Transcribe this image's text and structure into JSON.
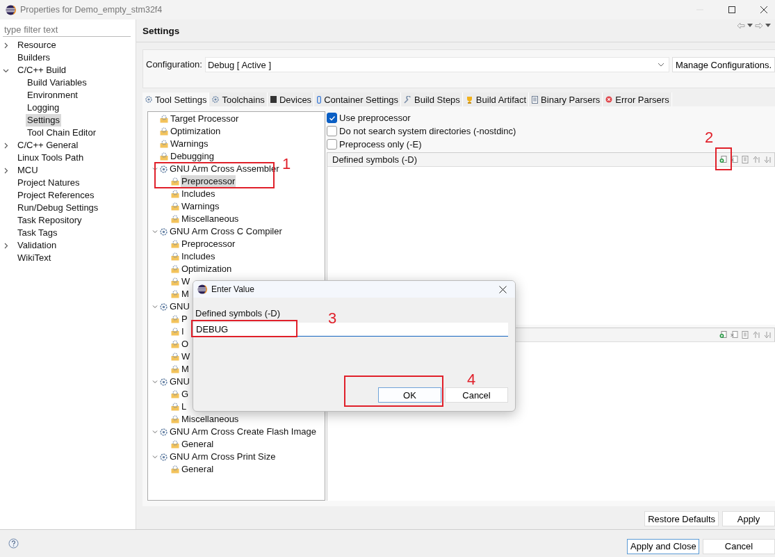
{
  "window": {
    "title": "Properties for Demo_empty_stm32f4"
  },
  "filter": {
    "placeholder": "type filter text"
  },
  "sidebar": {
    "items": [
      {
        "label": "Resource",
        "kind": "folder",
        "expanded": false,
        "selected": false
      },
      {
        "label": "Builders",
        "kind": "leaf",
        "selected": false
      },
      {
        "label": "C/C++ Build",
        "kind": "folder",
        "expanded": true,
        "selected": false,
        "children": [
          {
            "label": "Build Variables",
            "selected": false
          },
          {
            "label": "Environment",
            "selected": false
          },
          {
            "label": "Logging",
            "selected": false
          },
          {
            "label": "Settings",
            "selected": true
          },
          {
            "label": "Tool Chain Editor",
            "selected": false
          }
        ]
      },
      {
        "label": "C/C++ General",
        "kind": "folder",
        "expanded": false,
        "selected": false
      },
      {
        "label": "Linux Tools Path",
        "kind": "leaf",
        "selected": false
      },
      {
        "label": "MCU",
        "kind": "folder",
        "expanded": false,
        "selected": false
      },
      {
        "label": "Project Natures",
        "kind": "leaf",
        "selected": false
      },
      {
        "label": "Project References",
        "kind": "leaf",
        "selected": false
      },
      {
        "label": "Run/Debug Settings",
        "kind": "leaf",
        "selected": false
      },
      {
        "label": "Task Repository",
        "kind": "leaf",
        "selected": false
      },
      {
        "label": "Task Tags",
        "kind": "leaf",
        "selected": false
      },
      {
        "label": "Validation",
        "kind": "folder",
        "expanded": false,
        "selected": false
      },
      {
        "label": "WikiText",
        "kind": "leaf",
        "selected": false
      }
    ]
  },
  "page": {
    "title": "Settings"
  },
  "configuration": {
    "label": "Configuration:",
    "value": "Debug  [ Active ]",
    "manage_button": "Manage Configurations."
  },
  "tabs": [
    {
      "label": "Tool Settings",
      "kind": "tool",
      "selected": true
    },
    {
      "label": "Toolchains",
      "kind": "tool",
      "selected": false
    },
    {
      "label": "Devices",
      "kind": "device",
      "selected": false
    },
    {
      "label": "Container Settings",
      "kind": "container",
      "selected": false
    },
    {
      "label": "Build Steps",
      "kind": "steps",
      "selected": false
    },
    {
      "label": "Build Artifact",
      "kind": "artifact",
      "selected": false
    },
    {
      "label": "Binary Parsers",
      "kind": "parser",
      "selected": false
    },
    {
      "label": "Error Parsers",
      "kind": "error",
      "selected": false
    }
  ],
  "tool_tree": [
    {
      "kind": "option",
      "label": "Target Processor",
      "selected": false
    },
    {
      "kind": "option",
      "label": "Optimization",
      "selected": false
    },
    {
      "kind": "option",
      "label": "Warnings",
      "selected": false
    },
    {
      "kind": "option",
      "label": "Debugging",
      "selected": false
    },
    {
      "kind": "tool",
      "label": "GNU Arm Cross Assembler",
      "expanded": true,
      "selected": false,
      "children": [
        {
          "label": "Preprocessor",
          "selected": true
        },
        {
          "label": "Includes",
          "selected": false
        },
        {
          "label": "Warnings",
          "selected": false
        },
        {
          "label": "Miscellaneous",
          "selected": false
        }
      ]
    },
    {
      "kind": "tool",
      "label": "GNU Arm Cross C Compiler",
      "expanded": true,
      "selected": false,
      "children": [
        {
          "label": "Preprocessor",
          "selected": false
        },
        {
          "label": "Includes",
          "selected": false
        },
        {
          "label": "Optimization",
          "selected": false
        },
        {
          "label": "W",
          "selected": false
        },
        {
          "label": "M",
          "selected": false
        }
      ]
    },
    {
      "kind": "tool",
      "label": "GNU",
      "expanded": true,
      "selected": false,
      "children": [
        {
          "label": "P",
          "selected": false
        },
        {
          "label": "I",
          "selected": false
        },
        {
          "label": "O",
          "selected": false
        },
        {
          "label": "W",
          "selected": false
        },
        {
          "label": "M",
          "selected": false
        }
      ]
    },
    {
      "kind": "tool",
      "label": "GNU",
      "expanded": true,
      "selected": false,
      "children": [
        {
          "label": "G",
          "selected": false
        },
        {
          "label": "L",
          "selected": false
        },
        {
          "label": "Miscellaneous",
          "selected": false
        }
      ]
    },
    {
      "kind": "tool",
      "label": "GNU Arm Cross Create Flash Image",
      "expanded": true,
      "selected": false,
      "children": [
        {
          "label": "General",
          "selected": false
        }
      ]
    },
    {
      "kind": "tool",
      "label": "GNU Arm Cross Print Size",
      "expanded": true,
      "selected": false,
      "children": [
        {
          "label": "General",
          "selected": false
        }
      ]
    }
  ],
  "options": [
    {
      "label": "Use preprocessor",
      "checked": true
    },
    {
      "label": "Do not search system directories (-nostdinc)",
      "checked": false
    },
    {
      "label": "Preprocess only (-E)",
      "checked": false
    }
  ],
  "lists": [
    {
      "kind": "titled",
      "title": "Defined symbols (-D)"
    },
    {
      "kind": "covered"
    }
  ],
  "page_buttons": [
    "Restore Defaults",
    "Apply"
  ],
  "footer_buttons": [
    {
      "label": "Apply and Close",
      "default": true
    },
    {
      "label": "Cancel",
      "default": false
    }
  ],
  "dialog": {
    "title": "Enter Value",
    "label": "Defined symbols (-D)",
    "value": "DEBUG",
    "buttons": [
      {
        "label": "OK",
        "default": true
      },
      {
        "label": "Cancel",
        "default": false
      }
    ]
  },
  "annotations": [
    "1",
    "2",
    "3",
    "4"
  ]
}
